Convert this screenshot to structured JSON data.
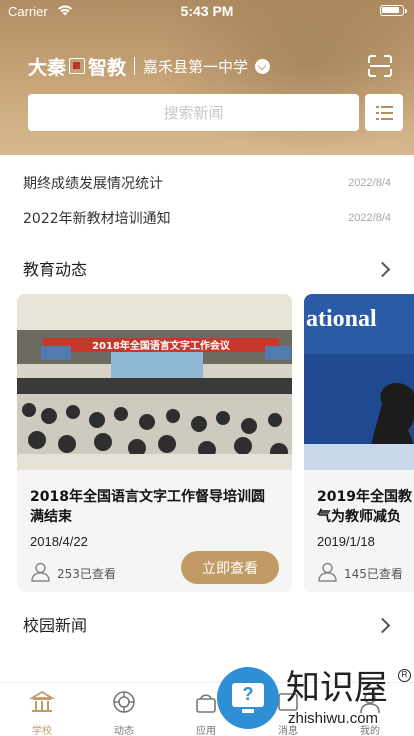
{
  "status_bar": {
    "carrier": "Carrier",
    "time": "5:43 PM"
  },
  "header": {
    "brand_part1": "大秦",
    "brand_part2": "智教",
    "school_name": "嘉禾县第一中学",
    "search_placeholder": "搜索新闻"
  },
  "notices": [
    {
      "title": "期终成绩发展情况统计",
      "date": "2022/8/4"
    },
    {
      "title": "2022年新教材培训通知",
      "date": "2022/8/4"
    }
  ],
  "sections": {
    "education_news": "教育动态",
    "campus_news": "校园新闻"
  },
  "cards": [
    {
      "banner_text": "2018年全国语言文字工作会议",
      "title": "2018年全国语言文字工作督导培训圆\n满结束",
      "date": "2018/4/22",
      "views": "253已查看",
      "button": "立即查看"
    },
    {
      "banner_text": "ational",
      "title": "2019年全国教\n气为教师减负",
      "date": "2019/1/18",
      "views": "145已查看"
    }
  ],
  "tabbar": {
    "items": [
      {
        "label": "学校",
        "icon": "school-icon",
        "active": true
      },
      {
        "label": "动态",
        "icon": "dynamics-icon",
        "active": false
      },
      {
        "label": "应用",
        "icon": "apps-icon",
        "active": false
      },
      {
        "label": "消息",
        "icon": "message-icon",
        "active": false
      },
      {
        "label": "我的",
        "icon": "profile-icon",
        "active": false
      }
    ]
  },
  "watermark": {
    "text": "知识屋",
    "url": "zhishiwu.com",
    "reg": "R"
  },
  "colors": {
    "accent": "#c29a66",
    "header_bg": "#c3a075",
    "card_bg": "#f5f5f5"
  }
}
